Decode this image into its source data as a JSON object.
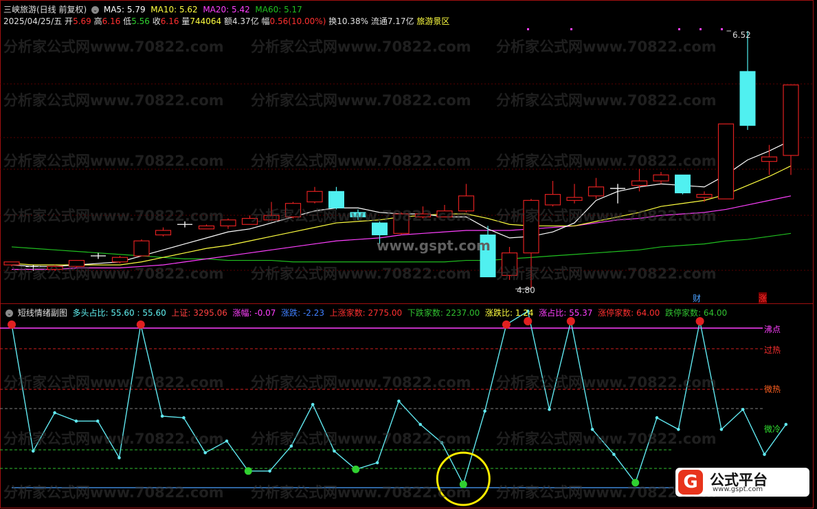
{
  "header": {
    "title": "三峡旅游(日线 前复权)",
    "ma5_label": "MA5: 5.79",
    "ma10_label": "MA10: 5.62",
    "ma20_label": "MA20: 5.42",
    "ma60_label": "MA60: 5.17",
    "date": "2025/04/25/五",
    "open_key": "开",
    "open_val": "5.69",
    "high_key": "高",
    "high_val": "6.16",
    "low_key": "低",
    "low_val": "5.56",
    "close_key": "收",
    "close_val": "6.16",
    "vol_key": "量",
    "vol_val": "744064",
    "amt_key": "额",
    "amt_val": "4.37亿",
    "chg_key": "幅",
    "chg_val": "0.56(10.00%)",
    "turnover": "换10.38%",
    "float": "流通7.17亿",
    "sector": "旅游景区"
  },
  "main_chart": {
    "price_high_label": "6.52",
    "price_low_label": "4.80",
    "tag_cai": "财",
    "tag_zhang": "涨"
  },
  "sub_header": {
    "title": "短线情绪副图",
    "bull_ratio_label": "多头占比: 55.60 : 55.60",
    "sh_index_key": "上证:",
    "sh_index_val": "3295.06",
    "amp_key": "涨幅:",
    "amp_val": "-0.07",
    "chg_key": "涨跌:",
    "chg_val": "-2.23",
    "up_count_key": "上涨家数:",
    "up_count_val": "2775.00",
    "down_count_key": "下跌家数:",
    "down_count_val": "2237.00",
    "ratio_key": "涨跌比:",
    "ratio_val": "1.24",
    "up_pct_key": "涨占比:",
    "up_pct_val": "55.37",
    "limit_up_key": "涨停家数:",
    "limit_up_val": "64.00",
    "limit_down_key": "跌停家数:",
    "limit_down_val": "64.00"
  },
  "levels": {
    "boil": "沸点",
    "overheat": "过热",
    "warm": "微热",
    "cool": "微冷"
  },
  "watermark": "分析家公式网www.70822.com",
  "watermark_center": "www.gspt.com",
  "logo": {
    "brand": "公式平台",
    "url": "www.gspt.com",
    "mark": "G"
  },
  "colors": {
    "up": "#e02020",
    "down": "#50f0f0",
    "ma5": "#ffffff",
    "ma10": "#ffff40",
    "ma20": "#ff40ff",
    "ma60": "#20c020"
  },
  "candles": [
    {
      "o": 4.96,
      "c": 4.98,
      "h": 4.98,
      "l": 4.95
    },
    {
      "o": 4.95,
      "c": 4.94,
      "h": 4.96,
      "l": 4.92
    },
    {
      "o": 4.93,
      "c": 4.95,
      "h": 4.96,
      "l": 4.92
    },
    {
      "o": 4.95,
      "c": 4.99,
      "h": 4.99,
      "l": 4.94
    },
    {
      "o": 5.02,
      "c": 5.02,
      "h": 5.04,
      "l": 5.0
    },
    {
      "o": 4.98,
      "c": 5.01,
      "h": 5.02,
      "l": 4.97
    },
    {
      "o": 5.02,
      "c": 5.12,
      "h": 5.13,
      "l": 5.02
    },
    {
      "o": 5.16,
      "c": 5.19,
      "h": 5.21,
      "l": 5.15
    },
    {
      "o": 5.23,
      "c": 5.23,
      "h": 5.25,
      "l": 5.21
    },
    {
      "o": 5.2,
      "c": 5.22,
      "h": 5.23,
      "l": 5.2
    },
    {
      "o": 5.22,
      "c": 5.26,
      "h": 5.27,
      "l": 5.2
    },
    {
      "o": 5.23,
      "c": 5.27,
      "h": 5.29,
      "l": 5.23
    },
    {
      "o": 5.26,
      "c": 5.29,
      "h": 5.38,
      "l": 5.26
    },
    {
      "o": 5.28,
      "c": 5.37,
      "h": 5.38,
      "l": 5.27
    },
    {
      "o": 5.38,
      "c": 5.45,
      "h": 5.48,
      "l": 5.37
    },
    {
      "o": 5.45,
      "c": 5.34,
      "h": 5.48,
      "l": 5.33
    },
    {
      "o": 5.31,
      "c": 5.28,
      "h": 5.33,
      "l": 5.26
    },
    {
      "o": 5.24,
      "c": 5.16,
      "h": 5.25,
      "l": 5.1
    },
    {
      "o": 5.17,
      "c": 5.3,
      "h": 5.31,
      "l": 5.16
    },
    {
      "o": 5.28,
      "c": 5.3,
      "h": 5.35,
      "l": 5.27
    },
    {
      "o": 5.28,
      "c": 5.32,
      "h": 5.36,
      "l": 5.28
    },
    {
      "o": 5.32,
      "c": 5.42,
      "h": 5.5,
      "l": 5.31
    },
    {
      "o": 5.16,
      "c": 4.88,
      "h": 5.22,
      "l": 4.88
    },
    {
      "o": 4.89,
      "c": 5.04,
      "h": 5.08,
      "l": 4.86
    },
    {
      "o": 5.04,
      "c": 5.39,
      "h": 5.4,
      "l": 4.8
    },
    {
      "o": 5.36,
      "c": 5.43,
      "h": 5.52,
      "l": 5.35
    },
    {
      "o": 5.39,
      "c": 5.41,
      "h": 5.5,
      "l": 5.37
    },
    {
      "o": 5.42,
      "c": 5.48,
      "h": 5.54,
      "l": 5.4
    },
    {
      "o": 5.47,
      "c": 5.47,
      "h": 5.5,
      "l": 5.37
    },
    {
      "o": 5.49,
      "c": 5.52,
      "h": 5.6,
      "l": 5.45
    },
    {
      "o": 5.52,
      "c": 5.56,
      "h": 5.58,
      "l": 5.5
    },
    {
      "o": 5.56,
      "c": 5.44,
      "h": 5.56,
      "l": 5.43
    },
    {
      "o": 5.41,
      "c": 5.43,
      "h": 5.45,
      "l": 5.38
    },
    {
      "o": 5.4,
      "c": 5.9,
      "h": 5.9,
      "l": 5.4
    },
    {
      "o": 6.25,
      "c": 5.89,
      "h": 6.52,
      "l": 5.86
    },
    {
      "o": 5.65,
      "c": 5.68,
      "h": 5.76,
      "l": 5.56
    },
    {
      "o": 5.69,
      "c": 6.16,
      "h": 6.16,
      "l": 5.56
    }
  ],
  "ma": {
    "ma5": [
      4.96,
      4.95,
      4.95,
      4.96,
      4.97,
      4.98,
      5.02,
      5.06,
      5.1,
      5.14,
      5.18,
      5.2,
      5.24,
      5.28,
      5.32,
      5.34,
      5.34,
      5.31,
      5.3,
      5.3,
      5.28,
      5.28,
      5.2,
      5.14,
      5.15,
      5.18,
      5.24,
      5.39,
      5.45,
      5.48,
      5.5,
      5.49,
      5.48,
      5.56,
      5.66,
      5.72,
      5.79
    ],
    "ma10": [
      4.97,
      4.96,
      4.96,
      4.96,
      4.96,
      4.96,
      4.98,
      5.01,
      5.04,
      5.07,
      5.09,
      5.12,
      5.15,
      5.18,
      5.21,
      5.24,
      5.25,
      5.26,
      5.28,
      5.29,
      5.3,
      5.3,
      5.27,
      5.23,
      5.22,
      5.22,
      5.22,
      5.25,
      5.28,
      5.31,
      5.35,
      5.37,
      5.39,
      5.43,
      5.49,
      5.55,
      5.62
    ],
    "ma20": [
      4.93,
      4.93,
      4.93,
      4.94,
      4.94,
      4.94,
      4.95,
      4.96,
      4.98,
      5.0,
      5.02,
      5.04,
      5.06,
      5.08,
      5.1,
      5.12,
      5.13,
      5.14,
      5.16,
      5.17,
      5.18,
      5.19,
      5.19,
      5.19,
      5.2,
      5.21,
      5.22,
      5.24,
      5.26,
      5.27,
      5.29,
      5.3,
      5.31,
      5.33,
      5.36,
      5.39,
      5.42
    ],
    "ma60": [
      5.08,
      5.07,
      5.06,
      5.05,
      5.04,
      5.03,
      5.02,
      5.01,
      5.0,
      5.0,
      4.99,
      4.99,
      4.99,
      4.98,
      4.98,
      4.98,
      4.98,
      4.98,
      4.98,
      4.98,
      4.98,
      4.99,
      4.99,
      5.0,
      5.01,
      5.02,
      5.03,
      5.04,
      5.05,
      5.06,
      5.08,
      5.09,
      5.1,
      5.12,
      5.13,
      5.15,
      5.17
    ]
  },
  "sentiment": [
    98,
    22,
    45,
    40,
    40,
    18,
    98,
    43,
    42,
    21,
    28,
    10,
    10,
    25,
    50,
    22,
    11,
    15,
    52,
    38,
    27,
    2,
    46,
    98,
    106,
    47,
    100,
    35,
    20,
    3,
    42,
    35,
    100,
    35,
    47,
    20,
    38
  ],
  "sentiment_markers": {
    "red": [
      0,
      6,
      23,
      24,
      26,
      32
    ],
    "green": [
      11,
      16,
      21,
      29
    ]
  }
}
